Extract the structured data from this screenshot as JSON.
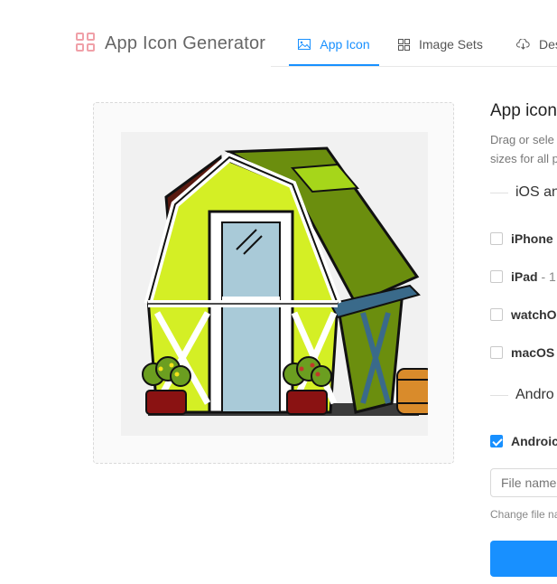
{
  "app": {
    "title": "App Icon Generator"
  },
  "tabs": [
    {
      "label": "App Icon",
      "icon": "image-icon",
      "active": true
    },
    {
      "label": "Image Sets",
      "icon": "grid-icon",
      "active": false
    },
    {
      "label": "Des",
      "icon": "cloud-download-icon",
      "active": false
    }
  ],
  "panel": {
    "title": "App icon",
    "desc_line1": "Drag or sele",
    "desc_line2": "sizes for all p"
  },
  "sections": {
    "ios": "iOS an",
    "android": "Andro"
  },
  "platforms": [
    {
      "label": "iPhone",
      "extra": "",
      "checked": false
    },
    {
      "label": "iPad",
      "extra": " - 1",
      "checked": false
    },
    {
      "label": "watchO",
      "extra": "",
      "checked": false
    },
    {
      "label": "macOS",
      "extra": "",
      "checked": false
    },
    {
      "label": "Androic",
      "extra": "",
      "checked": true
    }
  ],
  "filename": {
    "value": "File name"
  },
  "hint": "Change file na",
  "colors": {
    "accent": "#1890ff",
    "logo": "#f0a0a8"
  }
}
